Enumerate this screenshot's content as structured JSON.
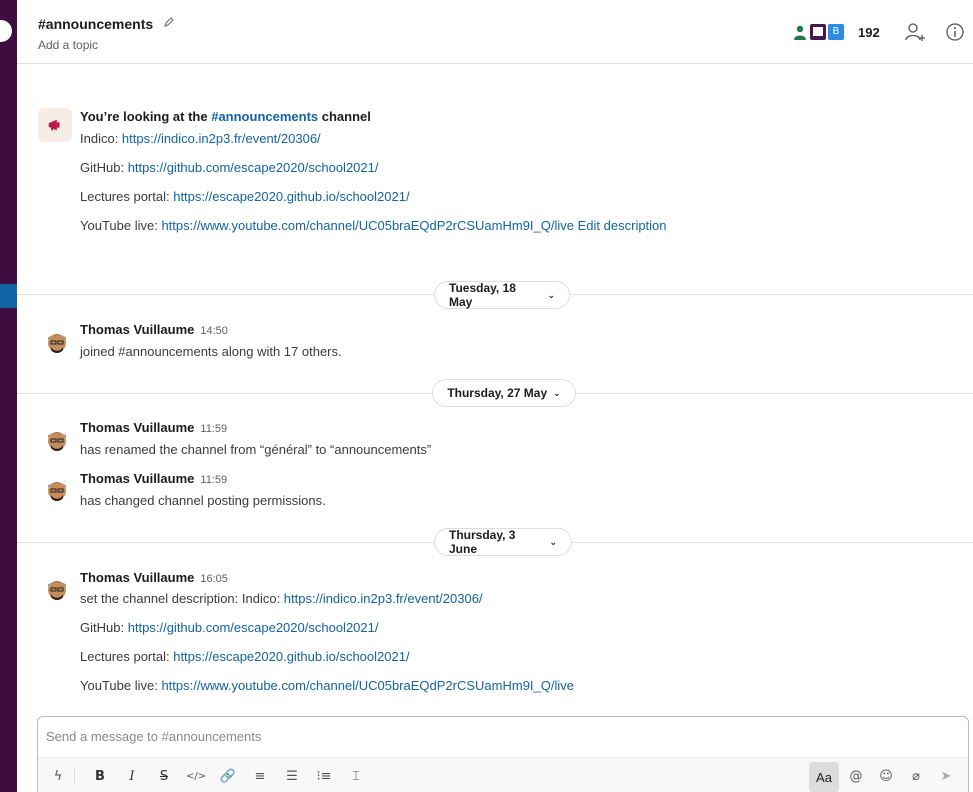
{
  "header": {
    "channel_name": "#announcements",
    "topic": "Add a topic",
    "member_avatar_letter": "B",
    "member_count": "192"
  },
  "intro": {
    "title_prefix": "You’re looking at the ",
    "title_channel": "#announcements",
    "title_suffix": " channel",
    "lines": [
      {
        "label": "Indico: ",
        "link": "https://indico.in2p3.fr/event/20306/"
      },
      {
        "label": "GitHub: ",
        "link": "https://github.com/escape2020/school2021/"
      },
      {
        "label": "Lectures portal: ",
        "link": "https://escape2020.github.io/school2021/"
      },
      {
        "label": "YouTube live: ",
        "link": "https://www.youtube.com/channel/UC05braEQdP2rCSUamHm9I_Q/live"
      }
    ],
    "edit_label": "Edit description"
  },
  "dates": [
    "Tuesday, 18 May",
    "Thursday, 27 May",
    "Thursday, 3 June"
  ],
  "messages": [
    {
      "author": "Thomas Vuillaume",
      "time": "14:50",
      "text": "joined #announcements along with 17 others."
    },
    {
      "author": "Thomas Vuillaume",
      "time": "11:59",
      "text": "has renamed the channel from “général” to “announcements”"
    },
    {
      "author": "Thomas Vuillaume",
      "time": "11:59",
      "text": "has changed channel posting permissions."
    },
    {
      "author": "Thomas Vuillaume",
      "time": "16:05",
      "text": "set the channel description: Indico: "
    }
  ],
  "description": {
    "indico_link": "https://indico.in2p3.fr/event/20306/",
    "lines": [
      {
        "label": "GitHub: ",
        "link": "https://github.com/escape2020/school2021/"
      },
      {
        "label": "Lectures portal: ",
        "link": "https://escape2020.github.io/school2021/"
      },
      {
        "label": "YouTube live: ",
        "link": "https://www.youtube.com/channel/UC05braEQdP2rCSUamHm9I_Q/live"
      }
    ]
  },
  "composer": {
    "placeholder": "Send a message to #announcements",
    "aa_label": "Aa"
  },
  "colors": {
    "sidebar": "#3f0e40",
    "link": "#1264a3",
    "active": "#1164a3"
  }
}
